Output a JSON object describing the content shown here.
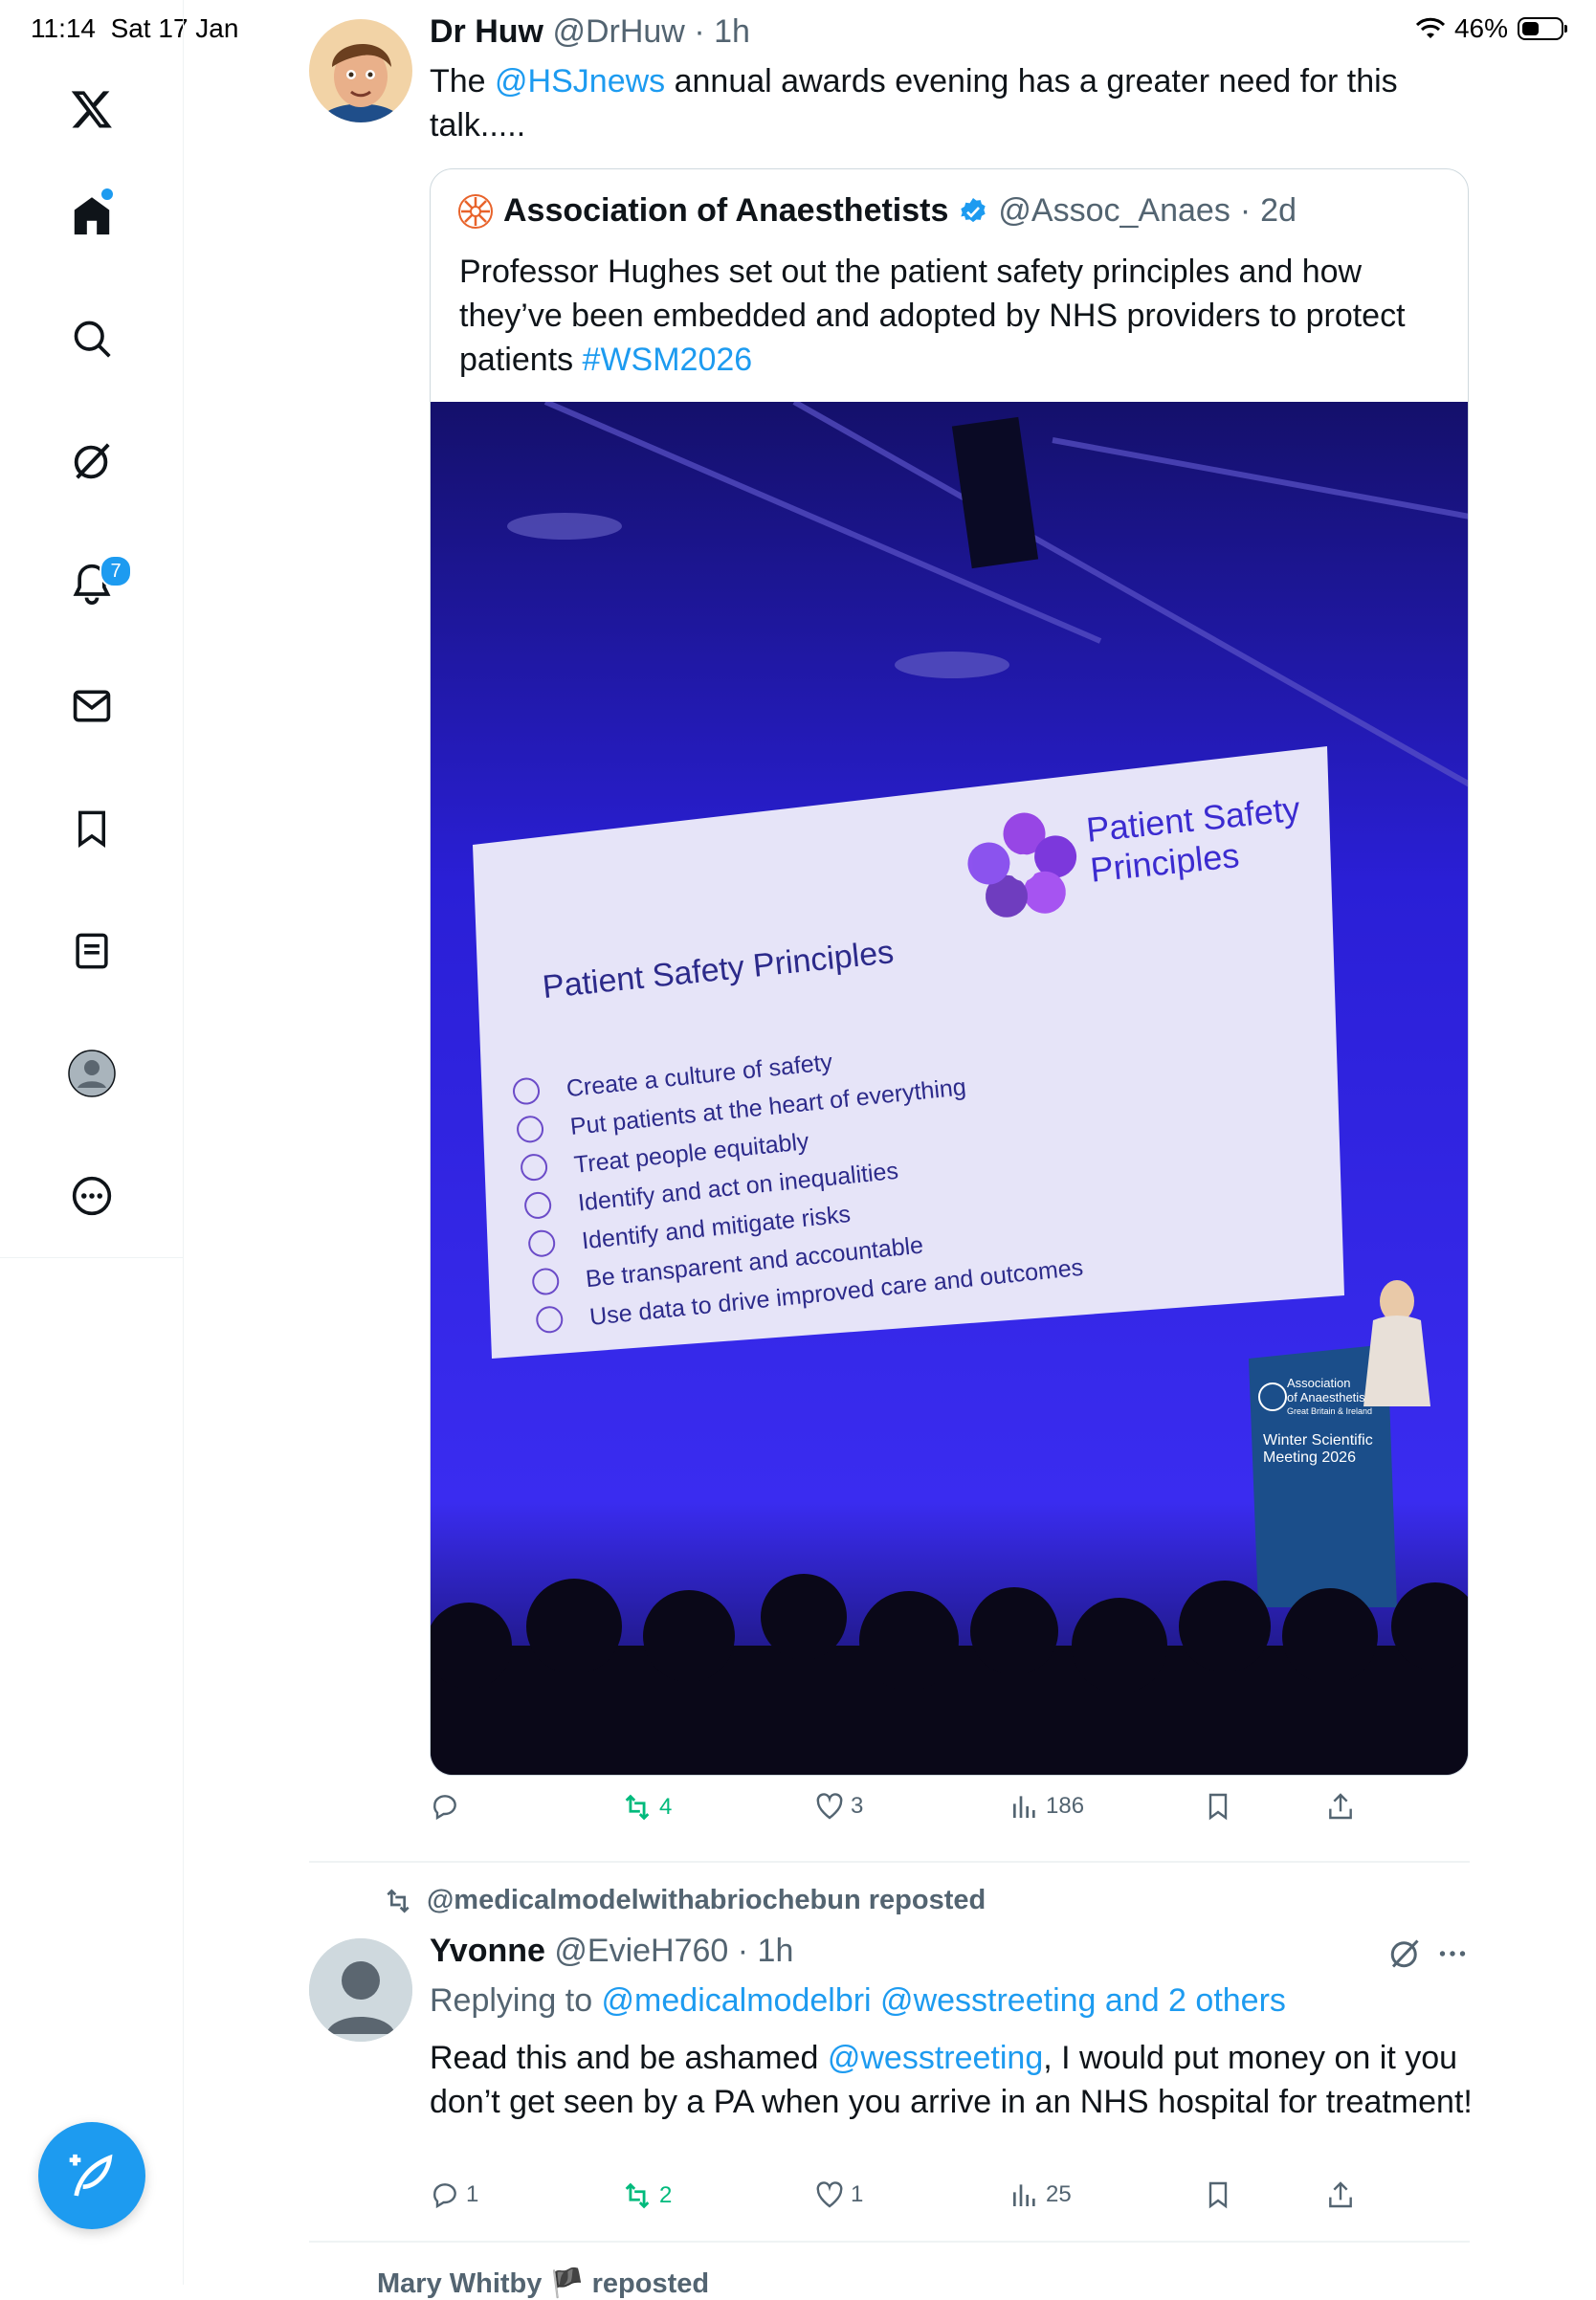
{
  "status_bar": {
    "time": "11:14",
    "date": "Sat 17 Jan",
    "battery": "46%",
    "battery_level": 0.46
  },
  "sidebar": {
    "notifications_count": "7",
    "items": [
      "x-logo-icon",
      "home-icon",
      "search-icon",
      "grok-icon",
      "notifications-icon",
      "messages-icon",
      "bookmarks-icon",
      "lists-icon",
      "profile-icon",
      "more-icon"
    ]
  },
  "tweet1": {
    "name": "Dr Huw",
    "handle": "@DrHuw",
    "time": "1h",
    "text_before": "The ",
    "mention": "@HSJnews",
    "text_after": " annual awards evening has a greater need for this talk.....",
    "quote": {
      "name": "Association of Anaesthetists",
      "handle": "@Assoc_Anaes",
      "time": "2d",
      "text": "Professor Hughes set out the patient safety principles and how they’ve been embedded and adopted by NHS providers to protect patients ",
      "hashtag": "#WSM2026",
      "slide": {
        "title": "Patient Safety Principles",
        "logo_text_1": "Patient Safety",
        "logo_text_2": "Principles",
        "items": [
          "Create a culture of safety",
          "Put patients at the heart of everything",
          "Treat people equitably",
          "Identify and act on inequalities",
          "Identify and mitigate risks",
          "Be transparent and accountable",
          "Use data to drive improved care and outcomes"
        ],
        "lectern_1": "Association",
        "lectern_2": "of Anaesthetists",
        "lectern_3": "Great Britain & Ireland",
        "lectern_4": "Winter Scientific",
        "lectern_5": "Meeting 2026"
      }
    },
    "actions": {
      "reposts": "4",
      "likes": "3",
      "views": "186"
    }
  },
  "tweet2": {
    "reposted_by": "@medicalmodelwithabriochebun reposted",
    "name": "Yvonne",
    "handle": "@EvieH760",
    "time": "1h",
    "replying_prefix": "Replying to ",
    "replying_targets": "@medicalmodelbri @wesstreeting and 2 others",
    "text_before": "Read this and be ashamed ",
    "mention": "@wesstreeting",
    "text_after": ", I would put money on it you don’t get seen by a PA when you arrive in an NHS hospital for treatment!",
    "actions": {
      "replies": "1",
      "reposts": "2",
      "likes": "1",
      "views": "25"
    }
  },
  "next_peek": "Mary Whitby 🏴 reposted",
  "colors": {
    "accent": "#1d9bf0",
    "repost_green": "#00ba7c",
    "muted": "#536471",
    "stage_blue": "#2a1fd6"
  }
}
